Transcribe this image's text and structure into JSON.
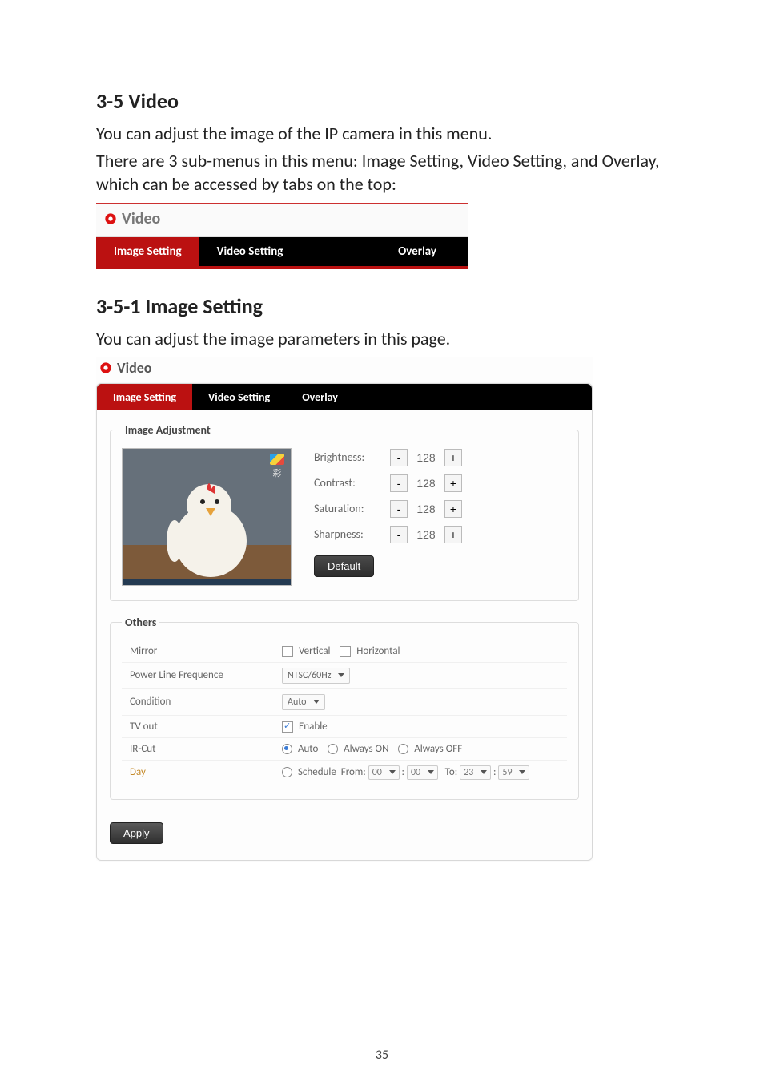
{
  "section_3_5": {
    "heading": "3-5 Video",
    "para1": "You can adjust the image of the IP camera in this menu.",
    "para2": "There are 3 sub-menus in this menu: Image Setting, Video Setting, and Overlay, which can be accessed by tabs on the top:"
  },
  "fig1": {
    "title": "Video",
    "tabs": {
      "image": "Image Setting",
      "video": "Video Setting",
      "overlay": "Overlay"
    }
  },
  "section_3_5_1": {
    "heading": "3-5-1 Image Setting",
    "para": "You can adjust the image parameters in this page."
  },
  "fig2": {
    "title": "Video",
    "tabs": {
      "image": "Image Setting",
      "video": "Video Setting",
      "overlay": "Overlay"
    },
    "image_adjustment": {
      "legend": "Image Adjustment",
      "color_icon_label": "彩",
      "params": {
        "brightness": {
          "label": "Brightness:",
          "value": "128"
        },
        "contrast": {
          "label": "Contrast:",
          "value": "128"
        },
        "saturation": {
          "label": "Saturation:",
          "value": "128"
        },
        "sharpness": {
          "label": "Sharpness:",
          "value": "128"
        }
      },
      "default_btn": "Default"
    },
    "others": {
      "legend": "Others",
      "mirror": {
        "label": "Mirror",
        "vertical": "Vertical",
        "horizontal": "Horizontal"
      },
      "plf": {
        "label": "Power Line Frequence",
        "value": "NTSC/60Hz"
      },
      "condition": {
        "label": "Condition",
        "value": "Auto"
      },
      "tvout": {
        "label": "TV out",
        "value": "Enable"
      },
      "ircut": {
        "label": "IR-Cut",
        "auto": "Auto",
        "always_on": "Always ON",
        "always_off": "Always OFF"
      },
      "day": {
        "label": "Day",
        "schedule": "Schedule",
        "from": "From:",
        "to": "To:",
        "from_h": "00",
        "from_m": "00",
        "to_h": "23",
        "to_m": "59"
      }
    },
    "apply": "Apply"
  },
  "page_number": "35"
}
